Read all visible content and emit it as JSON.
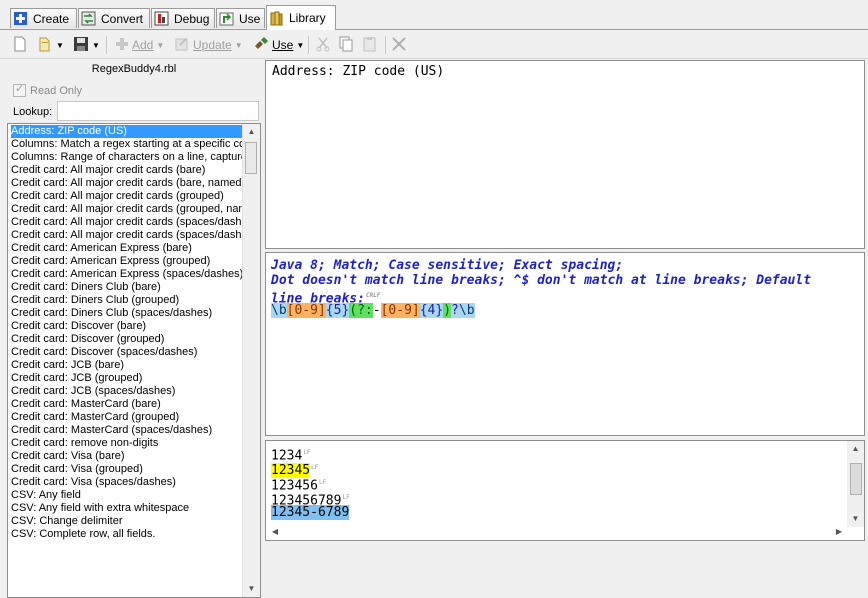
{
  "tabs": [
    {
      "label": "Create",
      "icon": "create-icon"
    },
    {
      "label": "Convert",
      "icon": "convert-icon"
    },
    {
      "label": "Debug",
      "icon": "debug-icon"
    },
    {
      "label": "Use",
      "icon": "use-icon"
    },
    {
      "label": "Library",
      "icon": "library-icon",
      "active": true
    }
  ],
  "toolbar": {
    "add_label": "Add",
    "update_label": "Update",
    "use_label": "Use"
  },
  "library": {
    "name": "RegexBuddy4.rbl",
    "read_only_label": "Read Only",
    "read_only_checked": true,
    "lookup_label": "Lookup:",
    "lookup_value": "",
    "items": [
      "Address: ZIP code (US)",
      "Columns: Match a regex starting at a specific co",
      "Columns: Range of characters on a line, capture",
      "Credit card: All major credit cards (bare)",
      "Credit card: All major credit cards (bare, named)",
      "Credit card: All major credit cards (grouped)",
      "Credit card: All major credit cards (grouped, nan",
      "Credit card: All major credit cards (spaces/dashes",
      "Credit card: All major credit cards (spaces/dashe",
      "Credit card: American Express (bare)",
      "Credit card: American Express (grouped)",
      "Credit card: American Express (spaces/dashes)",
      "Credit card: Diners Club (bare)",
      "Credit card: Diners Club (grouped)",
      "Credit card: Diners Club (spaces/dashes)",
      "Credit card: Discover (bare)",
      "Credit card: Discover (grouped)",
      "Credit card: Discover (spaces/dashes)",
      "Credit card: JCB (bare)",
      "Credit card: JCB (grouped)",
      "Credit card: JCB (spaces/dashes)",
      "Credit card: MasterCard (bare)",
      "Credit card: MasterCard (grouped)",
      "Credit card: MasterCard (spaces/dashes)",
      "Credit card: remove non-digits",
      "Credit card: Visa (bare)",
      "Credit card: Visa (grouped)",
      "Credit card: Visa (spaces/dashes)",
      "CSV: Any field",
      "CSV: Any field with extra whitespace",
      "CSV: Change delimiter",
      "CSV: Complete row, all fields."
    ],
    "selected_index": 0
  },
  "description": "Address: ZIP code (US)",
  "regex": {
    "comment_line1": "Java 8; Match; Case sensitive; Exact spacing;",
    "comment_line2": "Dot doesn't match line breaks; ^$ don't match at line breaks; Default",
    "comment_line3": "line breaks:",
    "tokens": [
      "\\b",
      "[0-9]",
      "{5}",
      "(?:",
      "-",
      "[0-9]",
      "{4}",
      ")",
      "?",
      "\\b"
    ]
  },
  "test": {
    "lines": [
      "1234",
      "12345",
      "123456",
      "123456789",
      "12345-6789"
    ]
  },
  "colors": {
    "selection": "#3399ff",
    "match_yellow": "#ffff00",
    "match_blue": "#80c0f0",
    "comment_blue": "#1f1fcc"
  }
}
